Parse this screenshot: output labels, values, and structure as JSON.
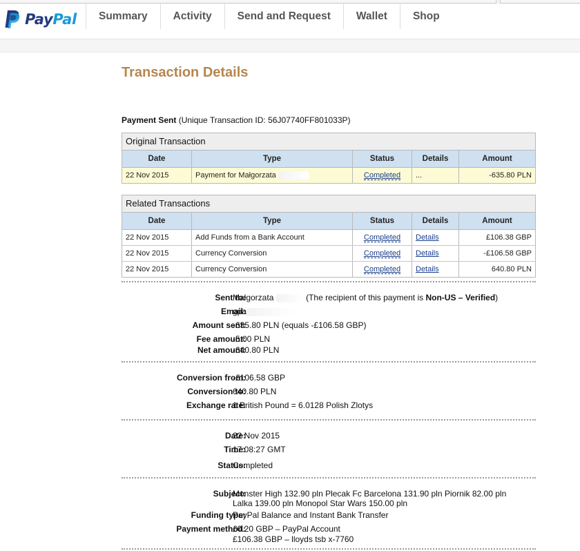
{
  "brand": {
    "logo_pay": "Pay",
    "logo_pal": "Pal"
  },
  "nav": {
    "items": [
      {
        "label": "Summary"
      },
      {
        "label": "Activity"
      },
      {
        "label": "Send and Request"
      },
      {
        "label": "Wallet"
      },
      {
        "label": "Shop"
      }
    ]
  },
  "page": {
    "title": "Transaction Details",
    "payment_type": "Payment Sent",
    "transaction_id_text": "(Unique Transaction ID: 56J07740FF801033P)"
  },
  "tables": {
    "headers": {
      "date": "Date",
      "type": "Type",
      "status": "Status",
      "details": "Details",
      "amount": "Amount"
    },
    "original": {
      "caption": "Original Transaction",
      "rows": [
        {
          "date": "22 Nov 2015",
          "type": "Payment for Małgorzata",
          "status": "Completed",
          "details": "...",
          "amount": "-635.80 PLN"
        }
      ]
    },
    "related": {
      "caption": "Related Transactions",
      "rows": [
        {
          "date": "22 Nov 2015",
          "type": "Add Funds from a Bank Account",
          "status": "Completed",
          "details": "Details",
          "amount": "£106.38 GBP"
        },
        {
          "date": "22 Nov 2015",
          "type": "Currency Conversion",
          "status": "Completed",
          "details": "Details",
          "amount": "-£106.58 GBP"
        },
        {
          "date": "22 Nov 2015",
          "type": "Currency Conversion",
          "status": "Completed",
          "details": "Details",
          "amount": "640.80 PLN"
        }
      ]
    }
  },
  "details": {
    "sent_to": {
      "label": "Sent to:",
      "name": "Małgorzata",
      "note_prefix": "(The recipient of this payment is ",
      "note_bold": "Non-US – Verified",
      "note_suffix": ")"
    },
    "email": {
      "label": "Email:",
      "value": "gpa"
    },
    "amount_sent": {
      "label": "Amount sent:",
      "value": "-635.80 PLN (equals -£106.58 GBP)"
    },
    "fee_amount": {
      "label": "Fee amount:",
      "value": "-5.00 PLN"
    },
    "net_amount": {
      "label": "Net amount:",
      "value": "-640.80 PLN"
    },
    "conversion_from": {
      "label": "Conversion from:",
      "value": "-£106.58 GBP"
    },
    "conversion_to": {
      "label": "Conversion to:",
      "value": "640.80 PLN"
    },
    "exchange_rate": {
      "label": "Exchange rate:",
      "value": "1 British Pound = 6.0128 Polish Zlotys"
    },
    "date": {
      "label": "Date:",
      "value": "22 Nov 2015"
    },
    "time": {
      "label": "Time:",
      "value": "17:08:27 GMT"
    },
    "status": {
      "label": "Status:",
      "value": "Completed"
    },
    "subject": {
      "label": "Subject:",
      "line1": "Monster High 132.90 pln Plecak Fc Barcelona 131.90 pln Piornik 82.00 pln",
      "line2": "Lalka 139.00 pln Monopol Star Wars 150.00 pln"
    },
    "funding_type": {
      "label": "Funding type:",
      "value": "PayPal Balance and Instant Bank Transfer"
    },
    "payment_method": {
      "label": "Payment method:",
      "line1": "£0.20 GBP – PayPal Account",
      "line2": "£106.38 GBP – lloyds tsb x-7760"
    }
  }
}
